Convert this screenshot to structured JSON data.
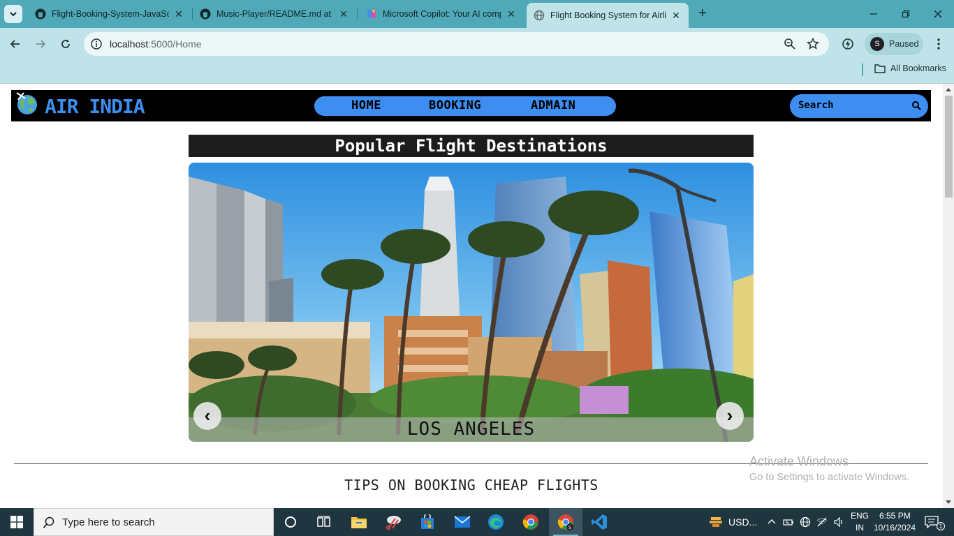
{
  "browser": {
    "tabs": [
      {
        "title": "Flight-Booking-System-JavaScr",
        "icon": "github-icon"
      },
      {
        "title": "Music-Player/README.md at m",
        "icon": "github-icon"
      },
      {
        "title": "Microsoft Copilot: Your AI comp",
        "icon": "copilot-icon"
      },
      {
        "title": "Flight Booking System for Airlin",
        "icon": "globe-icon",
        "active": true
      }
    ],
    "url_host": "localhost",
    "url_path": ":5000/Home",
    "profile_label": "Paused",
    "bookmarks_label": "All Bookmarks"
  },
  "site": {
    "brand": "AIR INDIA",
    "nav": [
      "HOME",
      "BOOKING",
      "ADMAIN"
    ],
    "search_placeholder": "Search",
    "section_title": "Popular Flight Destinations",
    "carousel_caption": "LOS ANGELES",
    "prev_glyph": "‹",
    "next_glyph": "›",
    "tips_title": "TIPS ON BOOKING CHEAP FLIGHTS"
  },
  "watermark": {
    "line1": "Activate Windows",
    "line2": "Go to Settings to activate Windows."
  },
  "taskbar": {
    "search_placeholder": "Type here to search",
    "weather": "USD...",
    "lang": "ENG",
    "region": "IN",
    "time": "6:55 PM",
    "date": "10/16/2024",
    "notification_count": "1"
  },
  "colors": {
    "tabstrip": "#4fa9b7",
    "toolbar": "#bfe3e8",
    "brand_blue": "#3d8ef0",
    "header_bg": "#000000",
    "taskbar": "#1f3640"
  }
}
